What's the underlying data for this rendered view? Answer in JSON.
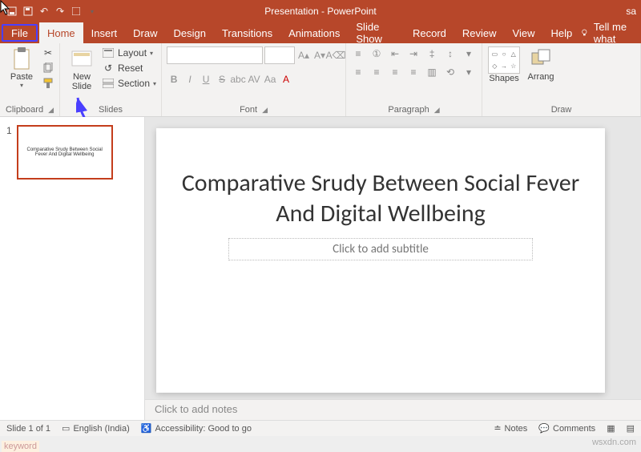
{
  "titlebar": {
    "title": "Presentation - PowerPoint",
    "user_fragment": "sa"
  },
  "menu": {
    "tabs": [
      "File",
      "Home",
      "Insert",
      "Draw",
      "Design",
      "Transitions",
      "Animations",
      "Slide Show",
      "Record",
      "Review",
      "View",
      "Help"
    ],
    "active": "Home",
    "tellme": "Tell me what"
  },
  "ribbon": {
    "clipboard": {
      "label": "Clipboard",
      "paste": "Paste"
    },
    "slides": {
      "label": "Slides",
      "newslide": "New\nSlide",
      "layout": "Layout",
      "reset": "Reset",
      "section": "Section"
    },
    "font": {
      "label": "Font",
      "bold": "B",
      "italic": "I",
      "underline": "U",
      "strike": "S",
      "shadow": "abc",
      "spacing": "AV",
      "case": "Aa",
      "clear": "A"
    },
    "paragraph": {
      "label": "Paragraph"
    },
    "drawing": {
      "label": "Draw",
      "shapes": "Shapes",
      "arrange": "Arrang"
    }
  },
  "thumb": {
    "num": "1",
    "title": "Comparative Srudy Between Social Fever And Digital Wellbeing"
  },
  "slide": {
    "title": "Comparative Srudy Between Social Fever And Digital Wellbeing",
    "subtitle_placeholder": "Click to add subtitle"
  },
  "notes_placeholder": "Click to add notes",
  "status": {
    "slide": "Slide 1 of 1",
    "lang": "English (India)",
    "access": "Accessibility: Good to go",
    "notes": "Notes",
    "comments": "Comments"
  },
  "watermark": "wsxdn.com",
  "keyword": "keyword"
}
